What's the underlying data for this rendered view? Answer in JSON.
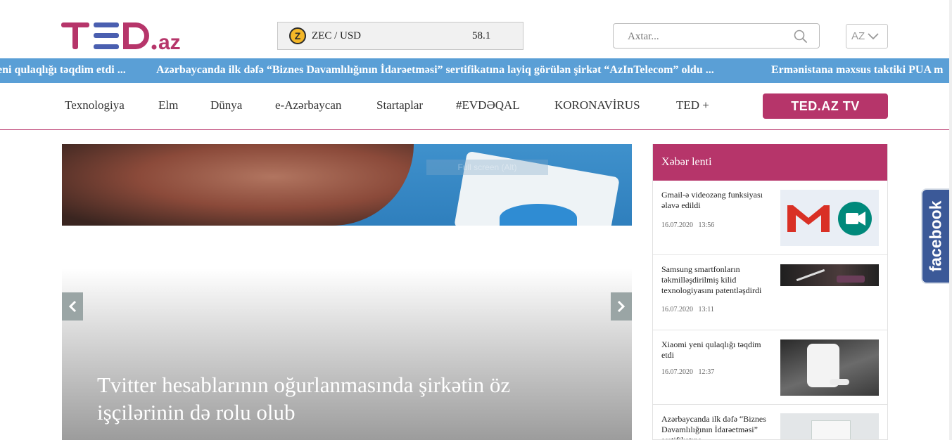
{
  "header": {
    "logo_text": "TED.az",
    "ticker": {
      "pair": "ZEC / USD",
      "price": "58.1",
      "icon": "zcash-coin-icon"
    },
    "search": {
      "placeholder": "Axtar...",
      "icon": "search-icon"
    },
    "language": {
      "current": "AZ"
    }
  },
  "marquee": {
    "items": [
      "eni qulaqlığı təqdim etdi ...",
      "Azərbaycanda ilk dəfə “Biznes Davamlılığının İdarəetməsi” sertifikatına layiq görülən şirkət “AzInTelecom” oldu ...",
      "Ermənistana məxsus taktiki PUA m"
    ]
  },
  "nav": {
    "items": [
      "Texnologiya",
      "Elm",
      "Dünya",
      "e-Azərbaycan",
      "Startaplar",
      "#EVDƏQAL",
      "KORONAVİRUS",
      "TED +"
    ],
    "tv_button": "TED.AZ TV"
  },
  "slider": {
    "fullscreen_label": "Full screen (Alt)",
    "title": "Tvitter hesablarının oğurlanmasında şirkətin öz işçilərinin də rolu olub"
  },
  "feed": {
    "heading": "Xəbər lenti",
    "items": [
      {
        "title": "Gmail-ə videozəng funksiyası əlavə edildi",
        "date": "16.07.2020",
        "time": "13:56"
      },
      {
        "title": "Samsung smartfonların təkmilləşdirilmiş kilid texnologiyasını patentləşdirdi",
        "date": "16.07.2020",
        "time": "13:11"
      },
      {
        "title": "Xiaomi yeni qulaqlığı təqdim etdi",
        "date": "16.07.2020",
        "time": "12:37"
      },
      {
        "title": "Azərbaycanda ilk dəfə “Biznes Davamlılığının İdarəetməsi” sertifikatına",
        "date": "",
        "time": ""
      }
    ]
  },
  "social": {
    "facebook_label": "facebook"
  },
  "colors": {
    "brand": "#b6356a",
    "marquee": "#5a9fd6",
    "facebook": "#3b5998"
  }
}
